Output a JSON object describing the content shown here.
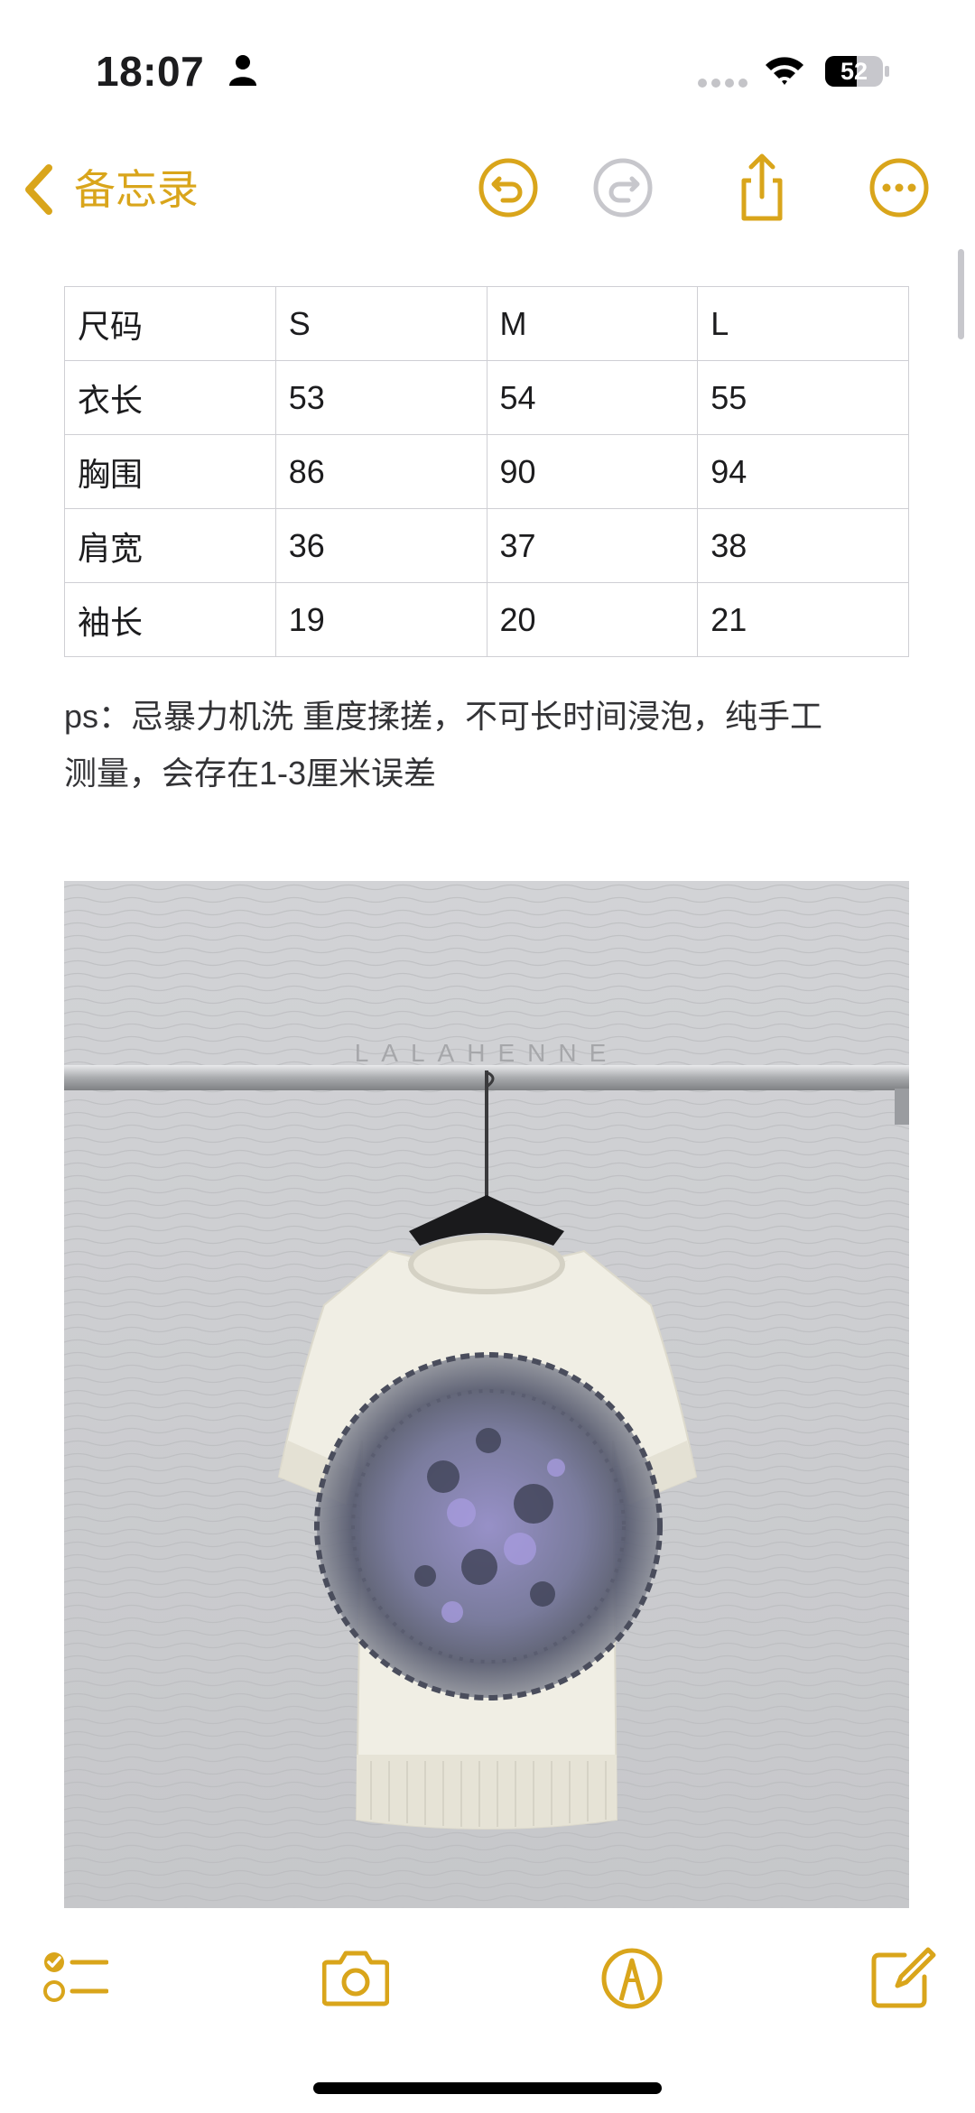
{
  "status_bar": {
    "time": "18:07",
    "battery_level": "52",
    "icons": [
      "person-icon",
      "signal-dots-icon",
      "wifi-icon",
      "battery-icon"
    ]
  },
  "nav": {
    "back_label": "备忘录",
    "buttons": [
      "undo-icon",
      "redo-icon",
      "share-icon",
      "more-icon"
    ],
    "accent_color": "#D9A51B",
    "disabled_color": "#C7C7CC"
  },
  "size_table": {
    "rows": [
      [
        "尺码",
        "S",
        "M",
        "L"
      ],
      [
        "衣长",
        "53",
        "54",
        "55"
      ],
      [
        "胸围",
        "86",
        "90",
        "94"
      ],
      [
        "肩宽",
        "36",
        "37",
        "38"
      ],
      [
        "袖长",
        "19",
        "20",
        "21"
      ]
    ]
  },
  "note": {
    "line1": "ps：忌暴力机洗 重度揉搓，不可长时间浸泡，纯手工",
    "line2": "测量，会存在1-3厘米误差"
  },
  "photo": {
    "watermark": "LALAHENNE",
    "subject_icon": "knit-tshirt-with-floral-medallion"
  },
  "toolbar": {
    "buttons": [
      "checklist-icon",
      "camera-icon",
      "markup-icon",
      "compose-icon"
    ]
  }
}
